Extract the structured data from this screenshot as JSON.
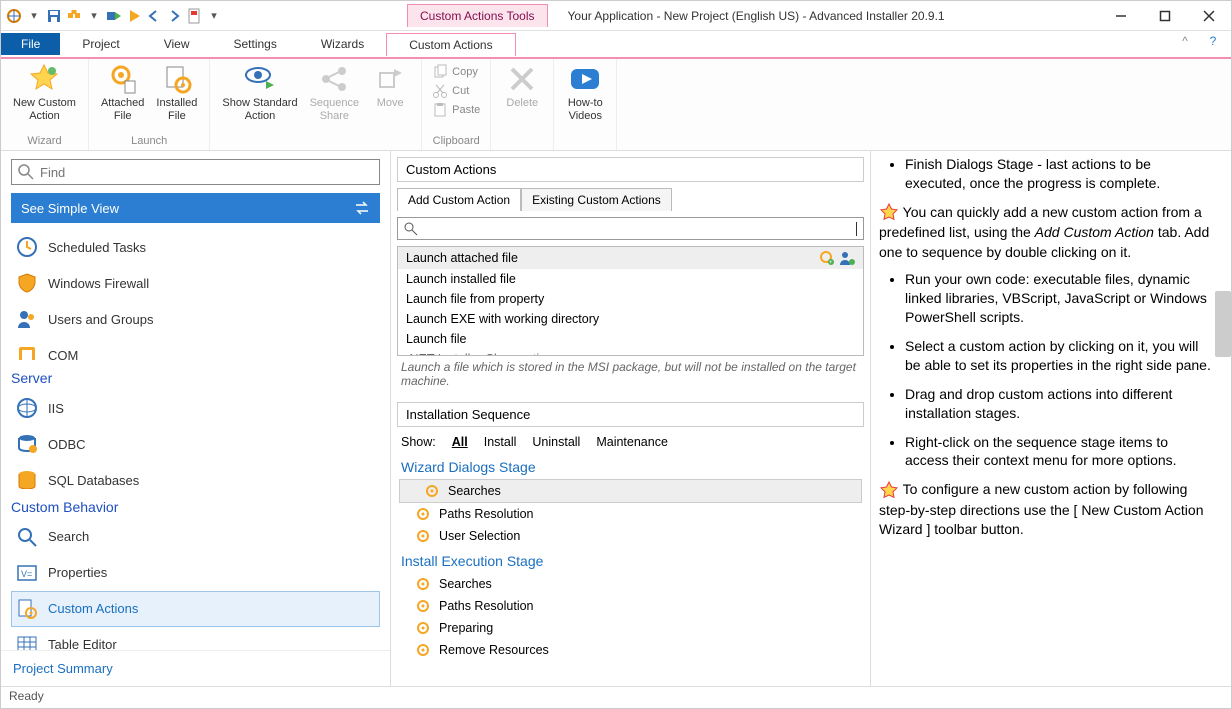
{
  "title": "Your Application - New Project (English US) - Advanced Installer 20.9.1",
  "toolTab": "Custom Actions Tools",
  "ribbonTabs": {
    "file": "File",
    "project": "Project",
    "view": "View",
    "settings": "Settings",
    "wizards": "Wizards",
    "custom": "Custom Actions"
  },
  "ribbon": {
    "wizard": {
      "label": "Wizard",
      "newCustom": "New Custom\nAction"
    },
    "launch": {
      "label": "Launch",
      "attached": "Attached\nFile",
      "installed": "Installed\nFile"
    },
    "showStd": "Show Standard\nAction",
    "seqShare": "Sequence\nShare",
    "move": "Move",
    "clipboard": {
      "label": "Clipboard",
      "copy": "Copy",
      "cut": "Cut",
      "paste": "Paste"
    },
    "delete": "Delete",
    "howto": "How-to\nVideos"
  },
  "find": {
    "placeholder": "Find"
  },
  "simpleView": "See Simple View",
  "nav": {
    "scheduled": "Scheduled Tasks",
    "firewall": "Windows Firewall",
    "users": "Users and Groups",
    "com": "COM",
    "server": "Server",
    "iis": "IIS",
    "odbc": "ODBC",
    "sql": "SQL Databases",
    "cb": "Custom Behavior",
    "search": "Search",
    "props": "Properties",
    "ca": "Custom Actions",
    "table": "Table Editor",
    "summary": "Project Summary"
  },
  "center": {
    "title": "Custom Actions",
    "tabAdd": "Add Custom Action",
    "tabExisting": "Existing Custom Actions",
    "list": {
      "0": "Launch attached file",
      "1": "Launch installed file",
      "2": "Launch file from property",
      "3": "Launch EXE with working directory",
      "4": "Launch file",
      "5": ".NET Installer Class action"
    },
    "desc": "Launch a file which is stored in the MSI package, but will not be installed on the target machine.",
    "seq": "Installation Sequence",
    "show": "Show:",
    "all": "All",
    "install": "Install",
    "uninstall": "Uninstall",
    "maint": "Maintenance",
    "wizStage": "Wizard Dialogs Stage",
    "searches": "Searches",
    "paths": "Paths Resolution",
    "usersel": "User Selection",
    "instStage": "Install Execution Stage",
    "preparing": "Preparing",
    "remove": "Remove Resources"
  },
  "right": {
    "l0": "Finish Dialogs Stage - last actions to be executed, once the progress is complete.",
    "p1a": "You can quickly add a new custom action from a predefined list, using the ",
    "p1b": "Add Custom Action",
    "p1c": " tab. Add one to sequence by double clicking on it.",
    "b1": "Run your own code: executable files, dynamic linked libraries, VBScript, JavaScript or Windows PowerShell scripts.",
    "b2": "Select a custom action by clicking on it, you will be able to set its properties in the right side pane.",
    "b3": "Drag and drop custom actions into different installation stages.",
    "b4": "Right-click on the sequence stage items to access their context menu for more options.",
    "p2": "To configure a new custom action by following step-by-step directions use the [ New Custom Action Wizard ] toolbar button."
  },
  "status": "Ready"
}
